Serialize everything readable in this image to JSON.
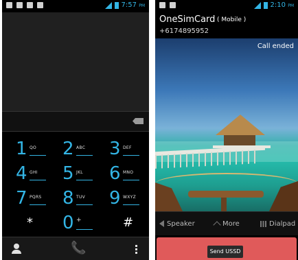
{
  "left": {
    "status_time": "7:57",
    "status_ampm": "PM",
    "keys": [
      {
        "digit": "1",
        "letters": "QO"
      },
      {
        "digit": "2",
        "letters": "ABC"
      },
      {
        "digit": "3",
        "letters": "DEF"
      },
      {
        "digit": "4",
        "letters": "GHI"
      },
      {
        "digit": "5",
        "letters": "JKL"
      },
      {
        "digit": "6",
        "letters": "MNO"
      },
      {
        "digit": "7",
        "letters": "PQRS"
      },
      {
        "digit": "8",
        "letters": "TUV"
      },
      {
        "digit": "9",
        "letters": "WXYZ"
      },
      {
        "digit": "*",
        "letters": ""
      },
      {
        "digit": "0",
        "letters": "+"
      },
      {
        "digit": "#",
        "letters": ""
      }
    ]
  },
  "right": {
    "status_time": "2:10",
    "status_ampm": "PM",
    "caller_name": "OneSimCard",
    "caller_type": "( Mobile )",
    "caller_number": "+6174895952",
    "call_state": "Call ended",
    "actions": {
      "speaker": "Speaker",
      "more": "More",
      "dialpad": "Dialpad"
    },
    "send_ussd": "Send USSD"
  },
  "colors": {
    "accent": "#33b5e5",
    "end_call": "#e05a5a"
  }
}
